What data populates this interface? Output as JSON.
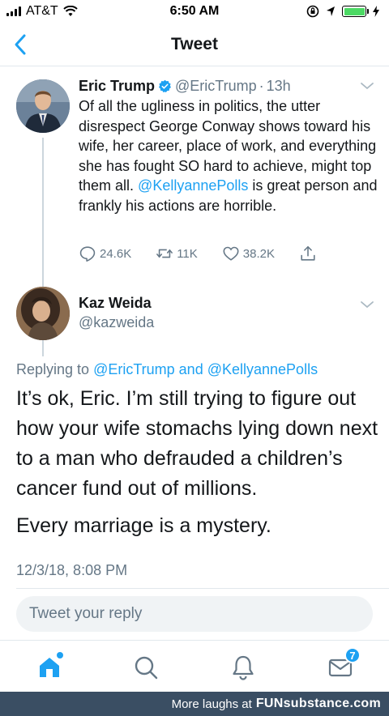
{
  "status_bar": {
    "carrier": "AT&T",
    "time": "6:50 AM"
  },
  "nav": {
    "title": "Tweet"
  },
  "tweet": {
    "name": "Eric Trump",
    "handle": "@EricTrump",
    "separator": "·",
    "time": "13h",
    "text_1": "Of all the ugliness in politics, the utter disrespect George Conway shows toward his wife, her career, place of work, and everything she has fought SO hard to achieve, might top them all.",
    "mention": "@KellyannePolls",
    "text_2": " is great person and frankly his actions are horrible.",
    "replies": "24.6K",
    "retweets": "11K",
    "likes": "38.2K"
  },
  "reply": {
    "name": "Kaz Weida",
    "handle": "@kazweida",
    "replying_prefix": "Replying to ",
    "replying_user1": "@EricTrump",
    "replying_and": " and ",
    "replying_user2": "@KellyannePolls",
    "paragraph_1": "It’s ok, Eric. I’m still trying to figure out how your wife stomachs lying down next to a man who defrauded a children’s cancer fund out of millions.",
    "paragraph_2": "Every marriage is a mystery.",
    "date": "12/3/18, 8:08 PM"
  },
  "reply_box": {
    "placeholder": "Tweet your reply"
  },
  "tabbar": {
    "messages_badge": "7"
  },
  "footer": {
    "text": "More laughs at",
    "brand": "FUNsubstance.com"
  },
  "colors": {
    "accent": "#1da1f2",
    "secondary_text": "#657786",
    "footer_bg": "#3a4e63"
  }
}
